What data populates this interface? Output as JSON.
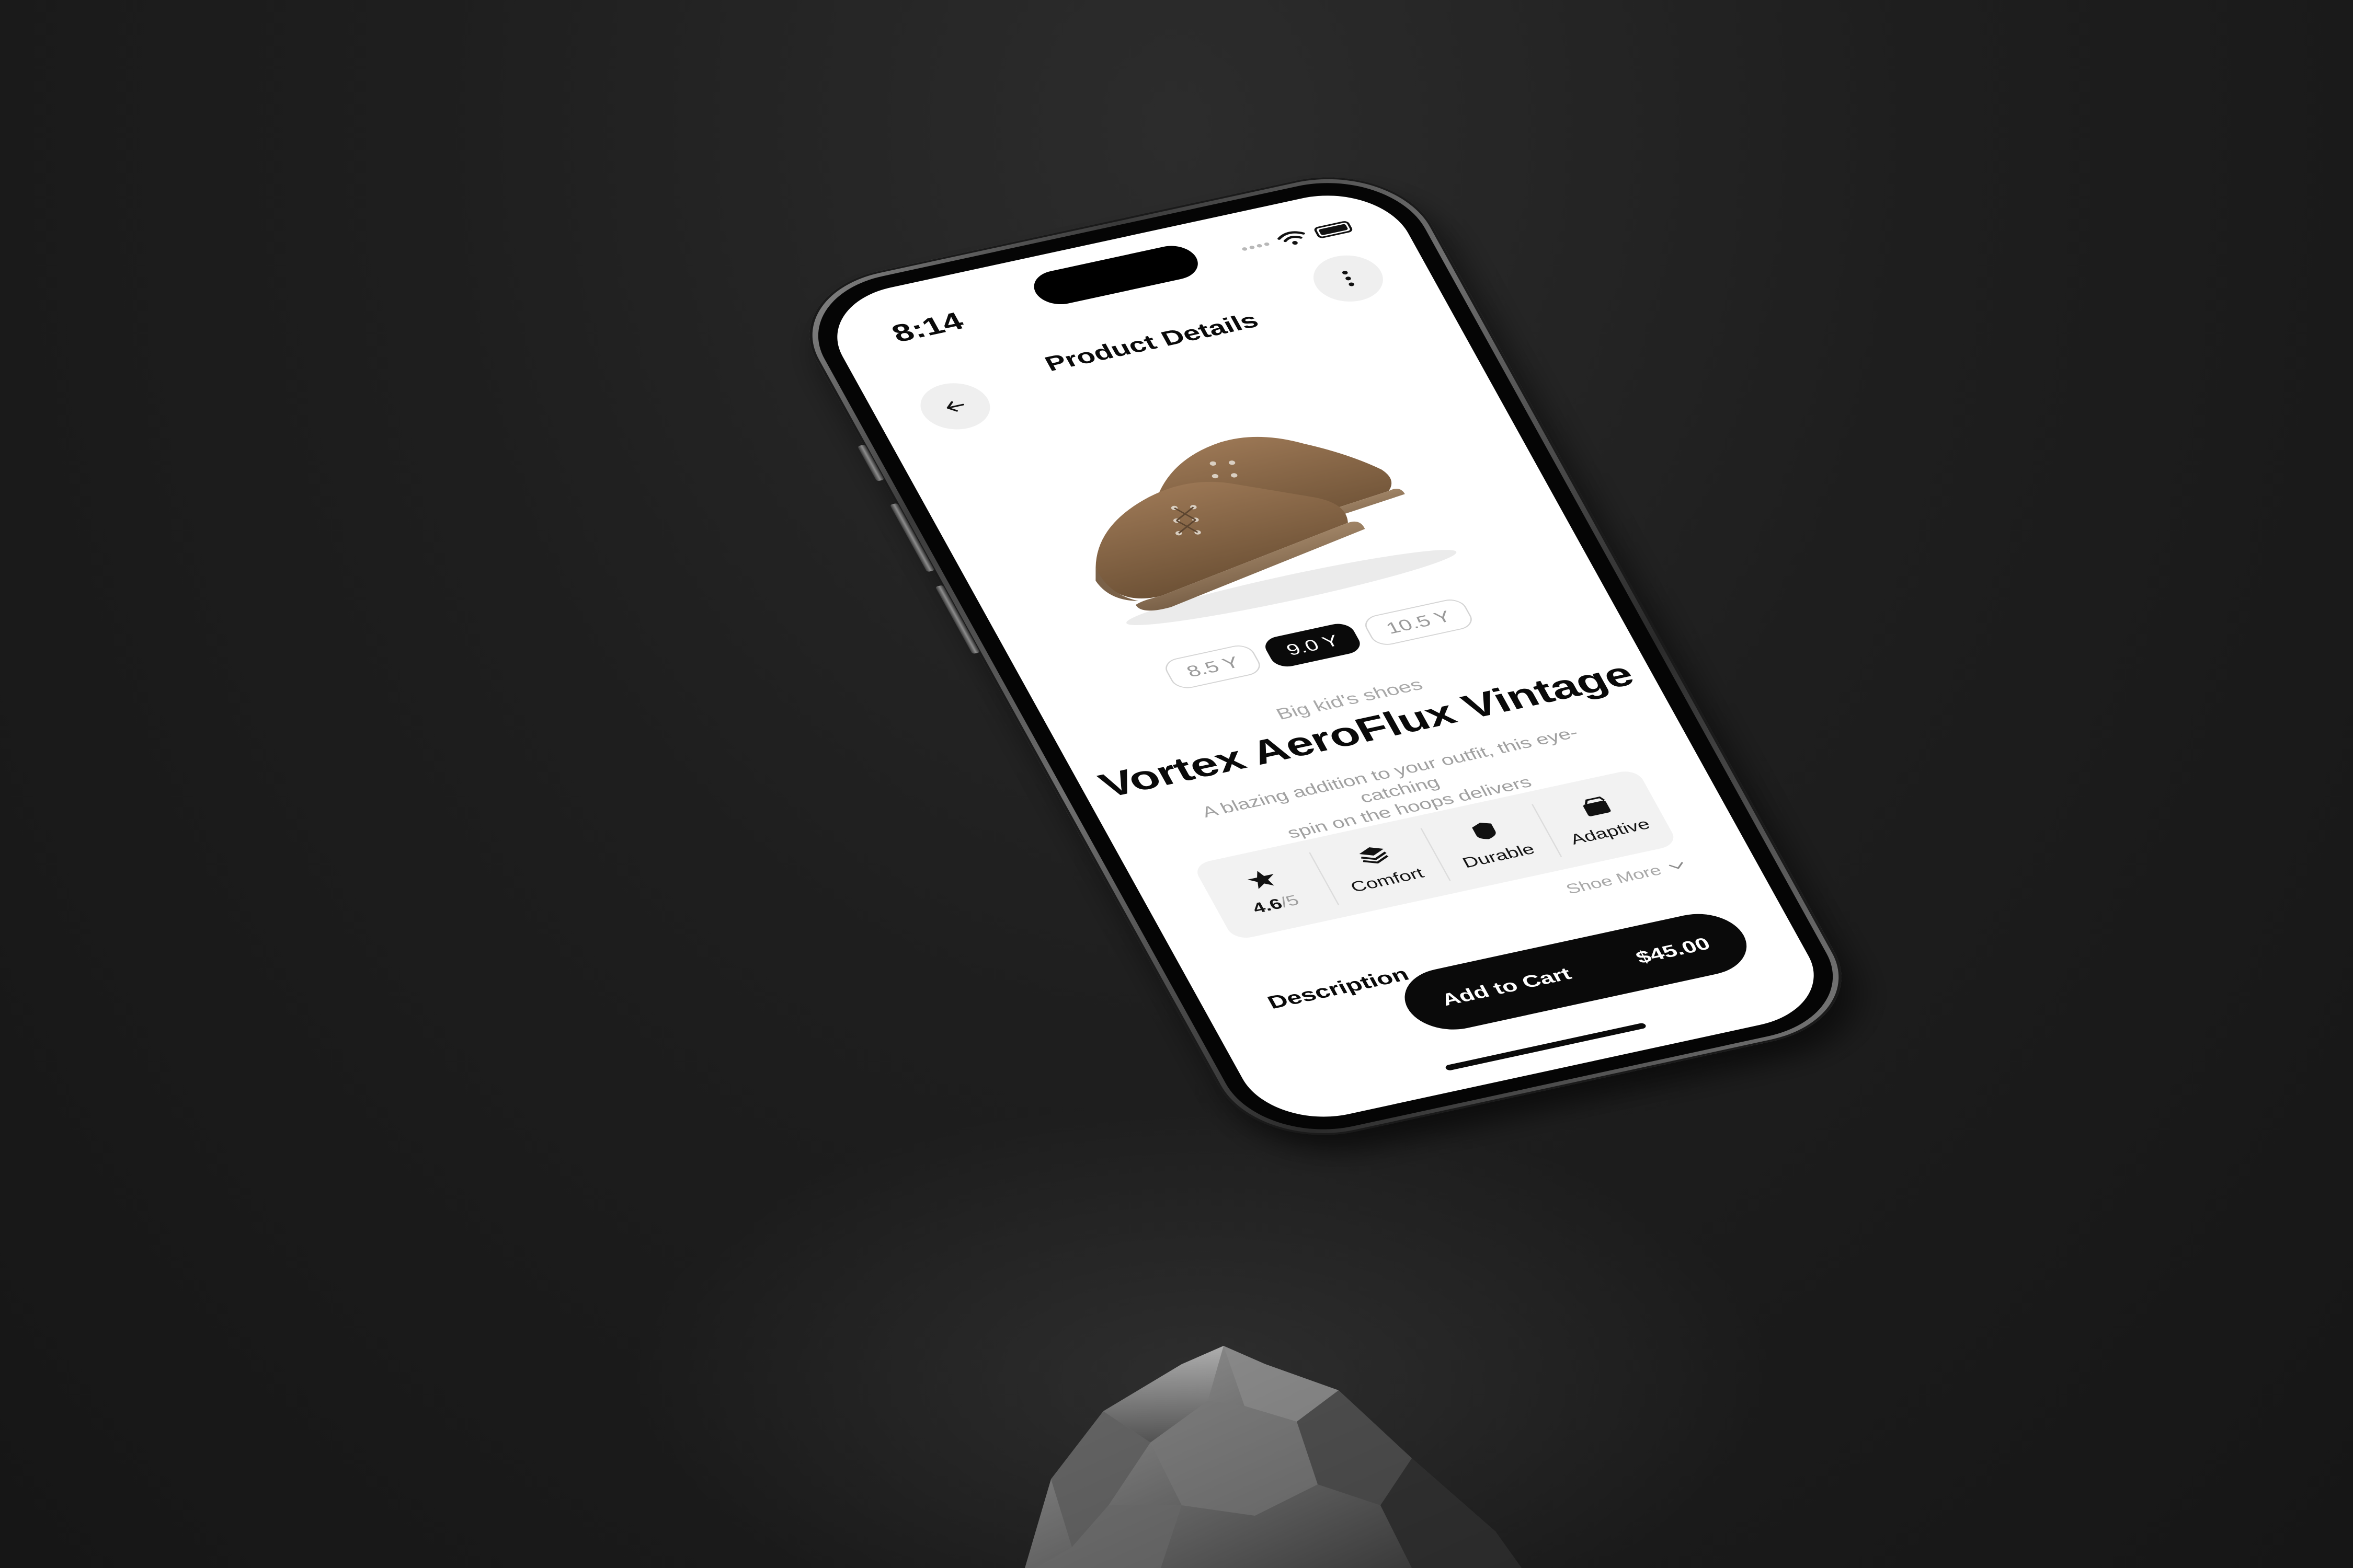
{
  "status_bar": {
    "time": "8:14",
    "icons": [
      "signal-dots-icon",
      "wifi-icon",
      "battery-icon"
    ]
  },
  "header": {
    "title": "Product Details",
    "back_icon": "arrow-left-icon",
    "more_icon": "more-vertical-icon"
  },
  "product": {
    "image": "brown-canvas-sneakers",
    "sizes": [
      {
        "label": "8.5 Y",
        "selected": false
      },
      {
        "label": "9.0 Y",
        "selected": true
      },
      {
        "label": "10.5 Y",
        "selected": false
      }
    ],
    "category": "Big kid's shoes",
    "name": "Vortex AeroFlux Vintage",
    "description_line1": "A blazing addition to your outfit, this eye-catching",
    "description_line2": "spin on the hoops delivers"
  },
  "features": {
    "rating": {
      "icon": "star-icon",
      "value": "4.6",
      "max": "/5"
    },
    "items": [
      {
        "icon": "layers-icon",
        "label": "Comfort"
      },
      {
        "icon": "shield-icon",
        "label": "Durable"
      },
      {
        "icon": "box-icon",
        "label": "Adaptive"
      }
    ],
    "show_more_label": "Shoe More",
    "show_more_icon": "chevron-down-icon"
  },
  "description": {
    "heading": "Description"
  },
  "cart": {
    "label": "Add to Cart",
    "price": "$45.00"
  },
  "colors": {
    "accent": "#0a0a0a",
    "background": "#1c1c1c",
    "surface": "#ffffff",
    "chip_border": "#d4d4d4",
    "muted_text": "#a0a0a0",
    "shoe": "#8b6a4a"
  }
}
